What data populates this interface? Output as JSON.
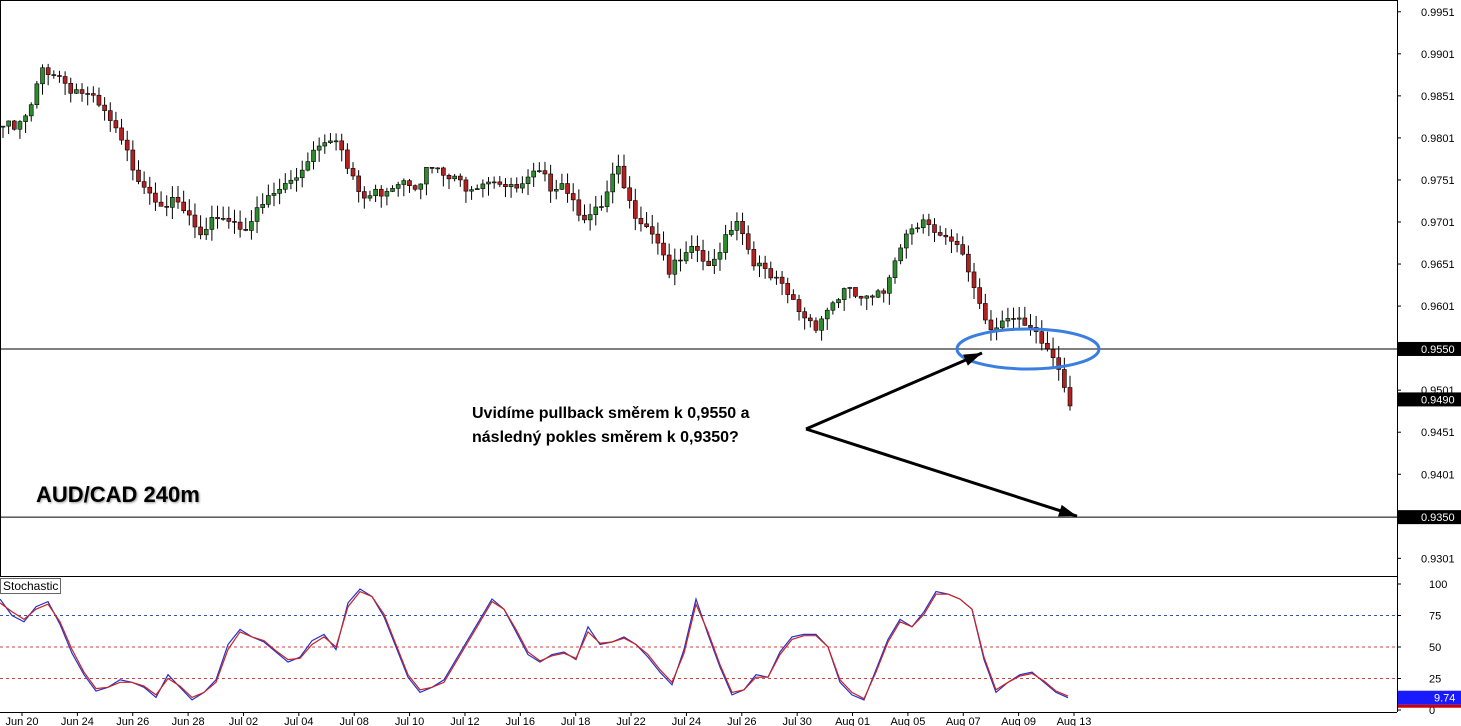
{
  "instrument": "AUD/CAD 240m",
  "annotation": {
    "line1": "Uvidíme pullback směrem k 0,9550 a",
    "line2": "následný pokles směrem k 0,9350?"
  },
  "indicator_label": "Stochastic",
  "colors": {
    "bull": "#2e8b2e",
    "bear": "#b22222",
    "wick": "#000000",
    "highlight_ellipse": "#3a7fe0",
    "stoch_k": "#2233cc",
    "stoch_d": "#cc2222",
    "price_tag_bg": "#000000",
    "stoch_tag_bg": "#1a1aff",
    "stoch_tag_low": "#cc0000"
  },
  "chart_data": [
    {
      "type": "candlestick",
      "title": "AUD/CAD 240m",
      "ylim": [
        0.928,
        0.9965
      ],
      "price_axis_ticks": [
        "0.9951",
        "0.9901",
        "0.9851",
        "0.9801",
        "0.9751",
        "0.9701",
        "0.9651",
        "0.9601",
        "0.9501",
        "0.9451",
        "0.9401",
        "0.9301"
      ],
      "date_ticks": [
        "Jun 20",
        "Jun 24",
        "Jun 26",
        "Jun 28",
        "Jul 02",
        "Jul 04",
        "Jul 08",
        "Jul 10",
        "Jul 12",
        "Jul 16",
        "Jul 18",
        "Jul 22",
        "Jul 24",
        "Jul 26",
        "Jul 30",
        "Aug 01",
        "Aug 05",
        "Aug 07",
        "Aug 09",
        "Aug 13"
      ],
      "horizontal_lines": [
        0.955,
        0.935
      ],
      "price_tags": [
        "0.9550",
        "0.9490",
        "0.9350"
      ],
      "close_path": [
        0.9815,
        0.981,
        0.983,
        0.9885,
        0.9878,
        0.9862,
        0.9855,
        0.984,
        0.982,
        0.979,
        0.976,
        0.974,
        0.9725,
        0.972,
        0.9705,
        0.9675,
        0.971,
        0.9705,
        0.9695,
        0.971,
        0.973,
        0.9742,
        0.9755,
        0.9782,
        0.9802,
        0.9805,
        0.9755,
        0.9728,
        0.9735,
        0.9745,
        0.9755,
        0.9748,
        0.9765,
        0.9755,
        0.9748,
        0.9745,
        0.9752,
        0.9755,
        0.9738,
        0.9742,
        0.9758,
        0.9745,
        0.9752,
        0.972,
        0.9705,
        0.9718,
        0.9765,
        0.972,
        0.9705,
        0.9685,
        0.9642,
        0.9655,
        0.9668,
        0.964,
        0.9682,
        0.9708,
        0.9665,
        0.964,
        0.9628,
        0.961,
        0.959,
        0.958,
        0.9602,
        0.9618,
        0.9612,
        0.9605,
        0.9615,
        0.9668,
        0.9695,
        0.9708,
        0.968,
        0.9675,
        0.9662,
        0.9615,
        0.9575,
        0.959,
        0.958,
        0.957,
        0.9555,
        0.9535,
        0.949
      ]
    },
    {
      "type": "line",
      "title": "Stochastic",
      "ylim": [
        0,
        100
      ],
      "y_ticks": [
        "100",
        "75",
        "50",
        "25",
        "0"
      ],
      "levels": [
        75,
        50,
        25
      ],
      "last_value_label": "9.74",
      "series": [
        {
          "values": [
            88,
            75,
            70,
            82,
            86,
            68,
            45,
            28,
            15,
            18,
            24,
            22,
            18,
            10,
            28,
            18,
            8,
            14,
            24,
            52,
            64,
            58,
            54,
            46,
            38,
            42,
            55,
            60,
            48,
            85,
            96,
            90,
            74,
            50,
            26,
            14,
            18,
            24,
            40,
            56,
            72,
            88,
            80,
            62,
            44,
            38,
            44,
            46,
            40,
            66,
            52,
            54,
            58,
            52,
            42,
            30,
            20,
            48,
            88,
            60,
            34,
            12,
            16,
            28,
            26,
            46,
            58,
            60,
            60,
            50,
            22,
            12,
            8,
            32,
            56,
            72,
            66,
            78,
            94,
            92,
            88,
            80,
            40,
            14,
            22,
            28,
            30,
            22,
            14,
            9.74
          ]
        },
        {
          "values": [
            85,
            78,
            72,
            80,
            84,
            70,
            48,
            30,
            17,
            18,
            22,
            22,
            19,
            12,
            25,
            19,
            10,
            14,
            22,
            48,
            62,
            58,
            55,
            47,
            40,
            41,
            52,
            58,
            50,
            82,
            94,
            90,
            76,
            52,
            28,
            16,
            18,
            22,
            38,
            54,
            70,
            86,
            80,
            64,
            46,
            39,
            43,
            45,
            41,
            62,
            53,
            54,
            57,
            52,
            44,
            32,
            22,
            45,
            84,
            62,
            36,
            14,
            16,
            26,
            26,
            44,
            56,
            59,
            59,
            50,
            24,
            14,
            9,
            30,
            54,
            70,
            66,
            76,
            92,
            92,
            88,
            80,
            42,
            16,
            22,
            27,
            29,
            23,
            15,
            11
          ]
        }
      ]
    }
  ]
}
